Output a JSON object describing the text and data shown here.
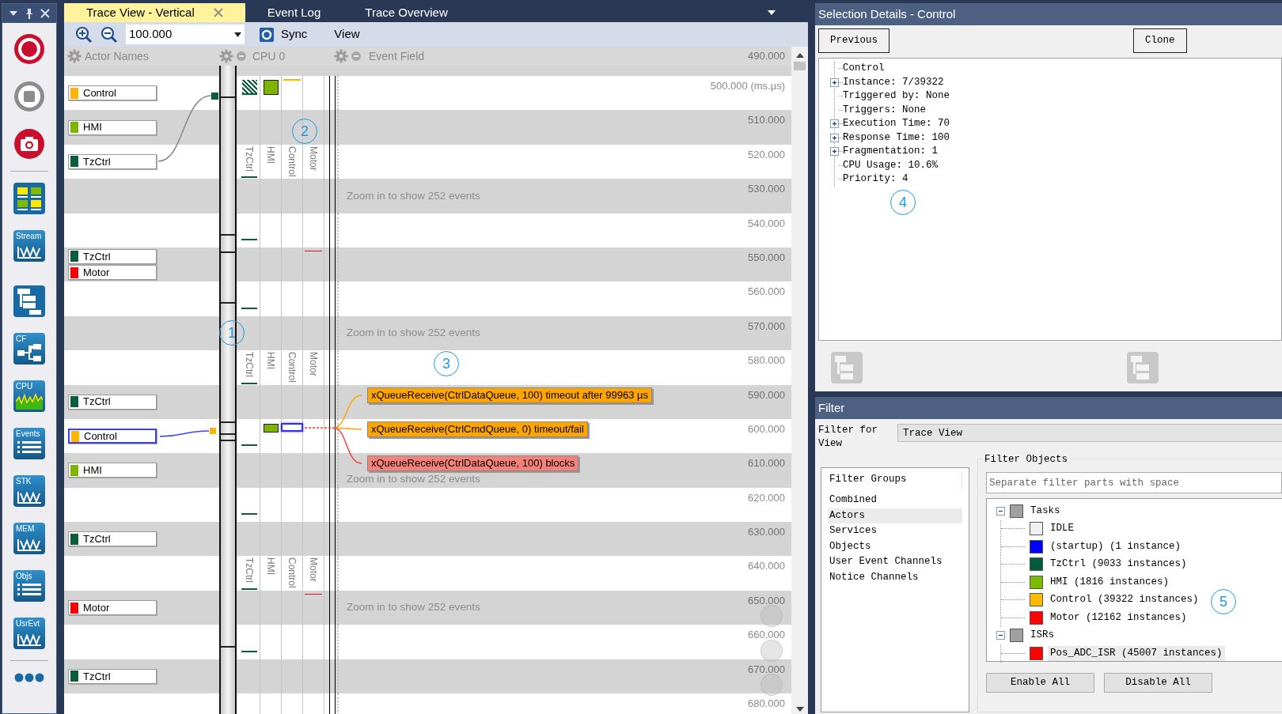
{
  "left_toolbar": {
    "tools": [
      {
        "kind": "record"
      },
      {
        "kind": "stop"
      },
      {
        "kind": "camera"
      },
      {
        "kind": "separator"
      },
      {
        "kind": "grid"
      },
      {
        "kind": "chart",
        "label": "Stream"
      },
      {
        "kind": "hierarchy"
      },
      {
        "kind": "flow",
        "label": "CF"
      },
      {
        "kind": "cpu",
        "label": "CPU"
      },
      {
        "kind": "list",
        "label": "Events"
      },
      {
        "kind": "chart",
        "label": "STK"
      },
      {
        "kind": "chart",
        "label": "MEM"
      },
      {
        "kind": "list",
        "label": "Objs"
      },
      {
        "kind": "chart",
        "label": "UsrEvt"
      },
      {
        "kind": "separator"
      },
      {
        "kind": "more"
      }
    ]
  },
  "tabs": [
    {
      "label": "Trace View - Vertical",
      "selected": true,
      "closable": true
    },
    {
      "label": "Event Log",
      "selected": false,
      "closable": false
    },
    {
      "label": "Trace Overview",
      "selected": false,
      "closable": false
    }
  ],
  "toolbar": {
    "zoom": "100.000",
    "sync": "Sync",
    "view": "View"
  },
  "trace": {
    "headers": {
      "actors": "Actor Names",
      "cpu": "CPU 0",
      "events": "Event Field",
      "tick": "490.000"
    },
    "lanes": [
      {
        "color": "#0b5e3c"
      },
      {
        "color": "#7cb400"
      },
      {
        "color": "#ffb400"
      },
      {
        "color": "#e81123"
      }
    ],
    "bands": [
      {
        "tick": "500.000 (ms.µs)",
        "actors": [
          {
            "name": "Control",
            "color": "#ffb400",
            "selected": false
          }
        ],
        "cpu": [
          {
            "kind": "hatched"
          },
          {
            "kind": "block"
          },
          {
            "kind": "line-top"
          },
          {
            "kind": "none"
          }
        ]
      },
      {
        "tick": "510.000",
        "actors": [
          {
            "name": "HMI",
            "color": "#7cb400",
            "selected": false
          }
        ]
      },
      {
        "tick": "520.000",
        "actors": [
          {
            "name": "TzCtrl",
            "color": "#0b5e3c",
            "selected": false
          }
        ],
        "lane_labels": [
          "TzCtrl",
          "HMI",
          "Control",
          "Motor"
        ],
        "cpu": [
          {
            "kind": "tick"
          },
          {
            "kind": "none"
          },
          {
            "kind": "none"
          },
          {
            "kind": "none"
          }
        ]
      },
      {
        "tick": "530.000",
        "zoom_hint": "Zoom in to show 252 events"
      },
      {
        "tick": "540.000",
        "cpu": [
          {
            "kind": "tick"
          },
          {
            "kind": "none"
          },
          {
            "kind": "none"
          },
          {
            "kind": "none"
          }
        ]
      },
      {
        "tick": "550.000",
        "actors": [
          {
            "name": "TzCtrl",
            "color": "#0b5e3c",
            "selected": false
          },
          {
            "name": "Motor",
            "color": "#ff0000",
            "selected": false
          }
        ],
        "cpu": [
          {
            "kind": "none"
          },
          {
            "kind": "none"
          },
          {
            "kind": "none"
          },
          {
            "kind": "line-top"
          }
        ]
      },
      {
        "tick": "560.000",
        "cpu": [
          {
            "kind": "tick"
          },
          {
            "kind": "none"
          },
          {
            "kind": "none"
          },
          {
            "kind": "none"
          }
        ]
      },
      {
        "tick": "570.000",
        "zoom_hint": "Zoom in to show 252 events"
      },
      {
        "tick": "580.000",
        "lane_labels": [
          "TzCtrl",
          "HMI",
          "Control",
          "Motor"
        ],
        "cpu": [
          {
            "kind": "tick"
          },
          {
            "kind": "none"
          },
          {
            "kind": "none"
          },
          {
            "kind": "none"
          }
        ]
      },
      {
        "tick": "590.000",
        "actors": [
          {
            "name": "TzCtrl",
            "color": "#0b5e3c",
            "selected": false
          }
        ],
        "event": {
          "text": "xQueueReceive(CtrlDataQueue, 100) timeout after 99963 µs",
          "color": "#ffa500"
        }
      },
      {
        "tick": "600.000",
        "actors": [
          {
            "name": "Control",
            "color": "#ffb400",
            "selected": true
          }
        ],
        "cpu": [
          {
            "kind": "tick"
          },
          {
            "kind": "block"
          },
          {
            "kind": "selected"
          },
          {
            "kind": "none"
          }
        ],
        "event": {
          "text": "xQueueReceive(CtrlCmdQueue, 0) timeout/fail",
          "color": "#ffa500"
        }
      },
      {
        "tick": "610.000",
        "actors": [
          {
            "name": "HMI",
            "color": "#7cb400",
            "selected": false
          }
        ],
        "event": {
          "text": "xQueueReceive(CtrlDataQueue, 100) blocks",
          "color": "#f4817a"
        },
        "zoom_hint": "Zoom in to show 252 events"
      },
      {
        "tick": "620.000",
        "cpu": [
          {
            "kind": "tick"
          },
          {
            "kind": "none"
          },
          {
            "kind": "none"
          },
          {
            "kind": "none"
          }
        ]
      },
      {
        "tick": "630.000",
        "actors": [
          {
            "name": "TzCtrl",
            "color": "#0b5e3c",
            "selected": false
          }
        ]
      },
      {
        "tick": "640.000",
        "lane_labels": [
          "TzCtrl",
          "HMI",
          "Control",
          "Motor"
        ],
        "cpu": [
          {
            "kind": "tick"
          },
          {
            "kind": "none"
          },
          {
            "kind": "none"
          },
          {
            "kind": "none"
          }
        ]
      },
      {
        "tick": "650.000",
        "actors": [
          {
            "name": "Motor",
            "color": "#ff0000",
            "selected": false
          }
        ],
        "zoom_hint": "Zoom in to show 252 events",
        "cpu": [
          {
            "kind": "none"
          },
          {
            "kind": "none"
          },
          {
            "kind": "none"
          },
          {
            "kind": "line-top"
          }
        ]
      },
      {
        "tick": "660.000",
        "cpu": [
          {
            "kind": "tick"
          },
          {
            "kind": "none"
          },
          {
            "kind": "none"
          },
          {
            "kind": "none"
          }
        ]
      },
      {
        "tick": "670.000",
        "actors": [
          {
            "name": "TzCtrl",
            "color": "#0b5e3c",
            "selected": false
          }
        ]
      },
      {
        "tick": "680.000"
      }
    ]
  },
  "details": {
    "title": "Selection Details - Control",
    "buttons": [
      "Previous",
      "Clone"
    ],
    "tree": [
      {
        "label": "Control",
        "expandable": false
      },
      {
        "label": "Instance: 7/39322",
        "expandable": true
      },
      {
        "label": "Triggered by: None",
        "expandable": false
      },
      {
        "label": "Triggers: None",
        "expandable": false
      },
      {
        "label": "Execution Time: 70",
        "expandable": true
      },
      {
        "label": "Response Time: 100",
        "expandable": true
      },
      {
        "label": "Fragmentation: 1",
        "expandable": true
      },
      {
        "label": "CPU Usage: 10.6%",
        "expandable": false
      },
      {
        "label": "Priority: 4",
        "expandable": false
      }
    ]
  },
  "filter": {
    "title": "Filter",
    "for_label": "Filter for View",
    "view": "Trace View",
    "groups_header": "Filter Groups",
    "groups": [
      {
        "label": "Combined",
        "selected": false
      },
      {
        "label": "Actors",
        "selected": true
      },
      {
        "label": "Services",
        "selected": false
      },
      {
        "label": "Objects",
        "selected": false
      },
      {
        "label": "User Event Channels",
        "selected": false
      },
      {
        "label": "Notice Channels",
        "selected": false
      }
    ],
    "objects_label": "Filter Objects",
    "search_placeholder": "Separate filter parts with space",
    "tree": [
      {
        "label": "Tasks",
        "color": "#a0a0a0",
        "expanded": true,
        "selected": false,
        "children": [
          {
            "label": "IDLE",
            "color": "#f0f0f0",
            "selected": false
          },
          {
            "label": "(startup) (1 instance)",
            "color": "#0000ff",
            "selected": false
          },
          {
            "label": "TzCtrl (9033 instances)",
            "color": "#005c3a",
            "selected": false
          },
          {
            "label": "HMI (1816 instances)",
            "color": "#7cbb00",
            "selected": false
          },
          {
            "label": "Control (39322 instances)",
            "color": "#ffb900",
            "selected": false
          },
          {
            "label": "Motor (12162 instances)",
            "color": "#ff0000",
            "selected": false
          }
        ]
      },
      {
        "label": "ISRs",
        "color": "#a0a0a0",
        "expanded": true,
        "selected": false,
        "children": [
          {
            "label": "Pos_ADC_ISR (45007 instances)",
            "color": "#ff0000",
            "selected": true
          }
        ]
      }
    ],
    "buttons": [
      "Enable All",
      "Disable All"
    ]
  },
  "callouts": [
    "1",
    "2",
    "3",
    "4",
    "5"
  ]
}
